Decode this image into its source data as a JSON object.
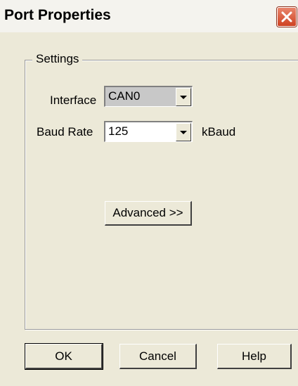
{
  "window": {
    "title": "Port Properties",
    "close_icon": "close-icon"
  },
  "settings": {
    "group_label": "Settings",
    "interface": {
      "label": "Interface",
      "value": "CAN0",
      "enabled": false
    },
    "baud_rate": {
      "label": "Baud Rate",
      "value": "125",
      "unit": "kBaud"
    },
    "advanced_label": "Advanced >>"
  },
  "buttons": {
    "ok": "OK",
    "cancel": "Cancel",
    "help": "Help"
  },
  "colors": {
    "dialog_bg": "#ece9d8",
    "close_button": "#d9512f",
    "disabled_field": "#c8c8c8"
  }
}
